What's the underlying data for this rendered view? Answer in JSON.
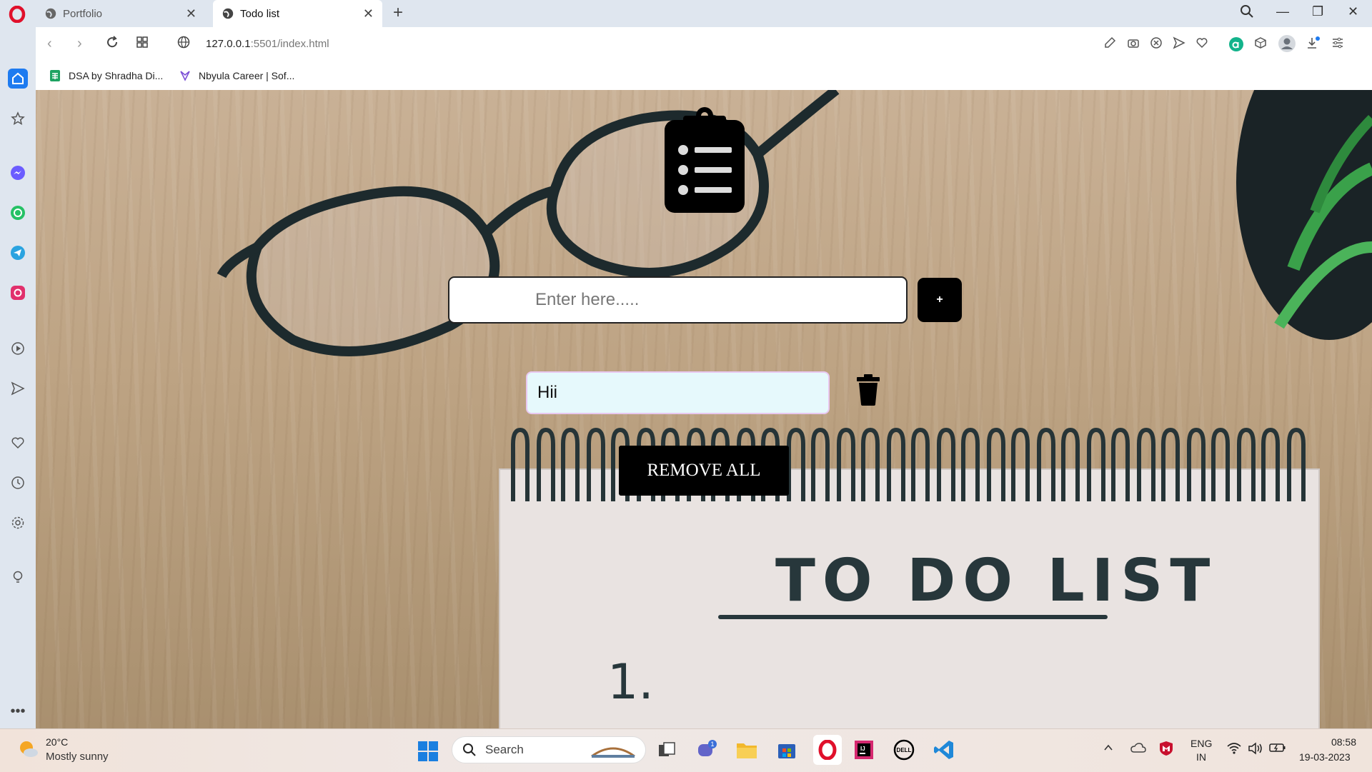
{
  "browser": {
    "tabs": [
      {
        "title": "Portfolio",
        "active": false
      },
      {
        "title": "Todo list",
        "active": true
      }
    ],
    "url_host": "127.0.0.1",
    "url_path": ":5501/index.html",
    "bookmarks": [
      {
        "label": "DSA by Shradha Di..."
      },
      {
        "label": "Nbyula Career | Sof..."
      }
    ]
  },
  "app": {
    "input_placeholder": "Enter here.....",
    "add_label": "+",
    "tasks": [
      {
        "text": "Hii"
      }
    ],
    "remove_all_label": "REMOVE ALL",
    "background_title": "TO DO LIST",
    "background_number": "1."
  },
  "taskbar": {
    "temperature": "20°C",
    "weather": "Mostly sunny",
    "search_label": "Search",
    "chat_badge": "1",
    "language": "ENG",
    "region": "IN",
    "time": "08:58",
    "date": "19-03-2023"
  },
  "colors": {
    "accent_opera": "#e0102b",
    "task_bg": "#e6f9fc",
    "button_bg": "#000000"
  }
}
